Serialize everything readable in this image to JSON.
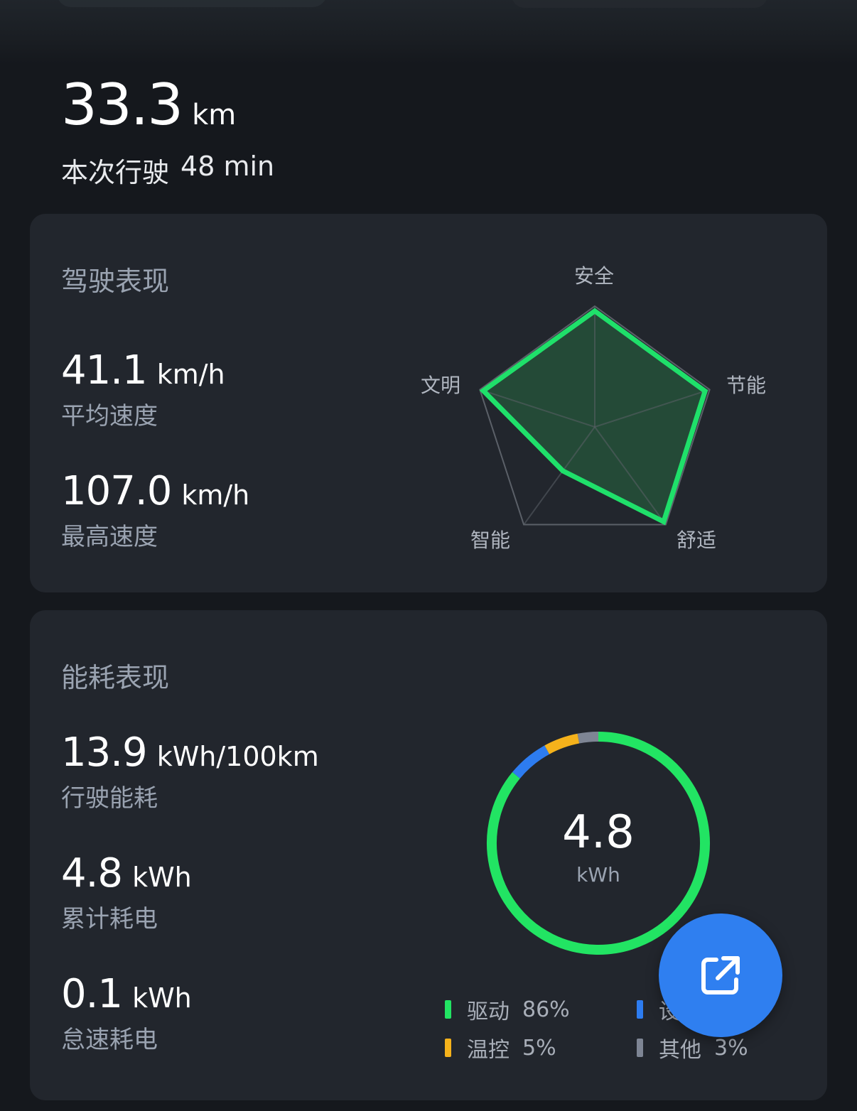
{
  "trip": {
    "distance": "33.3",
    "distance_unit": "km",
    "label": "本次行驶",
    "duration": "48 min"
  },
  "drive_card": {
    "title": "驾驶表现",
    "avg_speed": {
      "value": "41.1",
      "unit": "km/h",
      "label": "平均速度"
    },
    "max_speed": {
      "value": "107.0",
      "unit": "km/h",
      "label": "最高速度"
    },
    "radar": {
      "axes": [
        "安全",
        "节能",
        "舒适",
        "智能",
        "文明"
      ],
      "scores": [
        0.96,
        0.96,
        0.97,
        0.45,
        0.97
      ],
      "stroke_color": "#1fe06a",
      "fill_color": "#244a37",
      "grid_color": "#5b6068"
    }
  },
  "energy_card": {
    "title": "能耗表现",
    "consumption": {
      "value": "13.9",
      "unit": "kWh/100km",
      "label": "行驶能耗"
    },
    "total": {
      "value": "4.8",
      "unit": "kWh",
      "label": "累计耗电"
    },
    "idle": {
      "value": "0.1",
      "unit": "kWh",
      "label": "怠速耗电"
    },
    "donut": {
      "center_value": "4.8",
      "center_unit": "kWh",
      "segments": [
        {
          "name": "驱动",
          "percent": 86,
          "color": "#22e463"
        },
        {
          "name": "设",
          "percent": 6,
          "color": "#2d7cf0"
        },
        {
          "name": "温控",
          "percent": 5,
          "color": "#f5b21b"
        },
        {
          "name": "其他",
          "percent": 3,
          "color": "#7e8594"
        }
      ]
    },
    "legend": [
      {
        "label": "驱动",
        "percent": "86%",
        "color": "#22e463"
      },
      {
        "label": "设",
        "percent": "",
        "color": "#2d7cf0"
      },
      {
        "label": "温控",
        "percent": "5%",
        "color": "#f5b21b"
      },
      {
        "label": "其他",
        "percent": "3%",
        "color": "#7e8594"
      }
    ]
  },
  "fab": {
    "icon": "share-external-icon",
    "color": "#2f7ff0"
  }
}
